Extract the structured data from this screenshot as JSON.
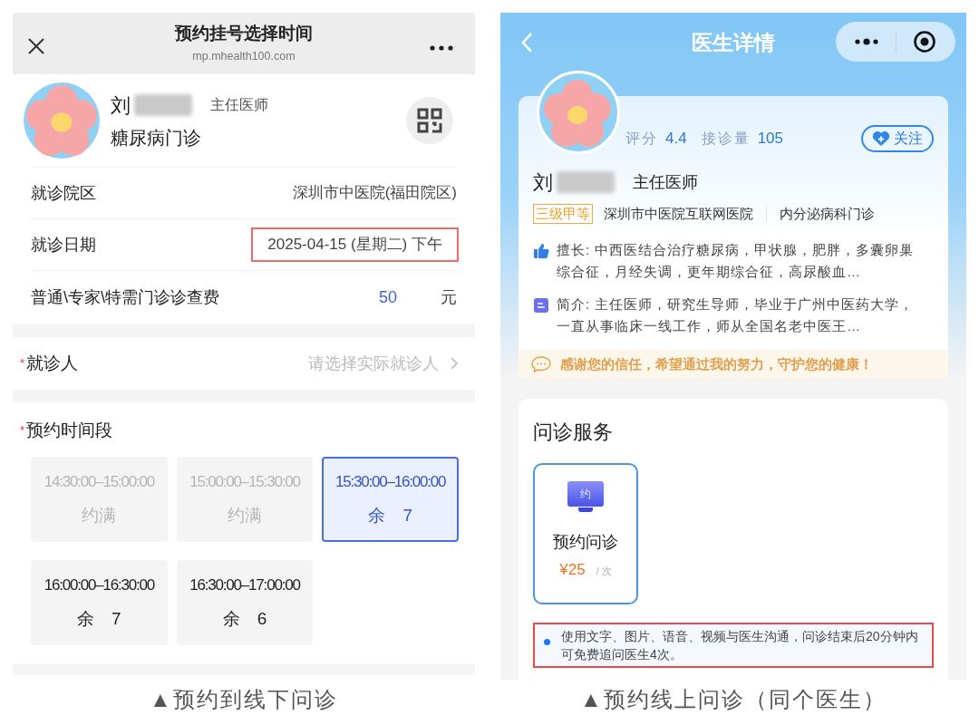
{
  "left_screen": {
    "title": "预约挂号选择时间",
    "url": "mp.mhealth100.com",
    "doctor": {
      "name": "刘",
      "title": "主任医师",
      "clinic": "糖尿病门诊"
    },
    "info_rows": [
      {
        "label": "就诊院区",
        "value": "深圳市中医院(福田院区)",
        "highlighted": false
      },
      {
        "label": "就诊日期",
        "value": "2025-04-15 (星期二) 下午",
        "highlighted": true
      }
    ],
    "fee": {
      "label": "普通\\专家\\特需门诊诊查费",
      "amount": "50",
      "unit": "元"
    },
    "patient": {
      "mark": "*",
      "label": "就诊人",
      "placeholder": "请选择实际就诊人"
    },
    "slots": {
      "mark": "*",
      "label": "预约时间段",
      "items": [
        {
          "time": "14:30:00–15:00:00",
          "status": "约满",
          "available": false,
          "selected": false
        },
        {
          "time": "15:00:00–15:30:00",
          "status": "约满",
          "available": false,
          "selected": false
        },
        {
          "time": "15:30:00–16:00:00",
          "status": "余　7",
          "available": true,
          "selected": true
        },
        {
          "time": "16:00:00–16:30:00",
          "status": "余　7",
          "available": true,
          "selected": false
        },
        {
          "time": "16:30:00–17:00:00",
          "status": "余　6",
          "available": true,
          "selected": false
        }
      ]
    },
    "caption": "▲预约到线下问诊"
  },
  "right_screen": {
    "title": "医生详情",
    "stats": [
      {
        "label": "评分",
        "value": "4.4"
      },
      {
        "label": "接诊量",
        "value": "105"
      }
    ],
    "follow_button": "关注",
    "doctor": {
      "name": "刘",
      "title": "主任医师",
      "grade": "三级甲等",
      "hospital": "深圳市中医院互联网医院",
      "department": "内分泌病科门诊"
    },
    "bio": [
      {
        "kind": "specialty",
        "text": "擅长: 中西医结合治疗糖尿病，甲状腺，肥胖，多囊卵巢综合征，月经失调，更年期综合征，高尿酸血…"
      },
      {
        "kind": "intro",
        "text": "简介: 主任医师，研究生导师，毕业于广州中医药大学，一直从事临床一线工作，师从全国名老中医王…"
      }
    ],
    "quote": "感谢您的信任，希望通过我的努力，守护您的健康！",
    "services_title": "问诊服务",
    "services": [
      {
        "icon_label": "约",
        "name": "预约问诊",
        "price": "¥25",
        "unit": "/ 次",
        "selected": true
      }
    ],
    "note": {
      "text": "使用文字、图片、语音、视频与医生沟通，问诊结束后20分钟内可免费追问医生4次。",
      "highlighted": true
    },
    "caption": "▲预约线上问诊（同个医生）"
  }
}
